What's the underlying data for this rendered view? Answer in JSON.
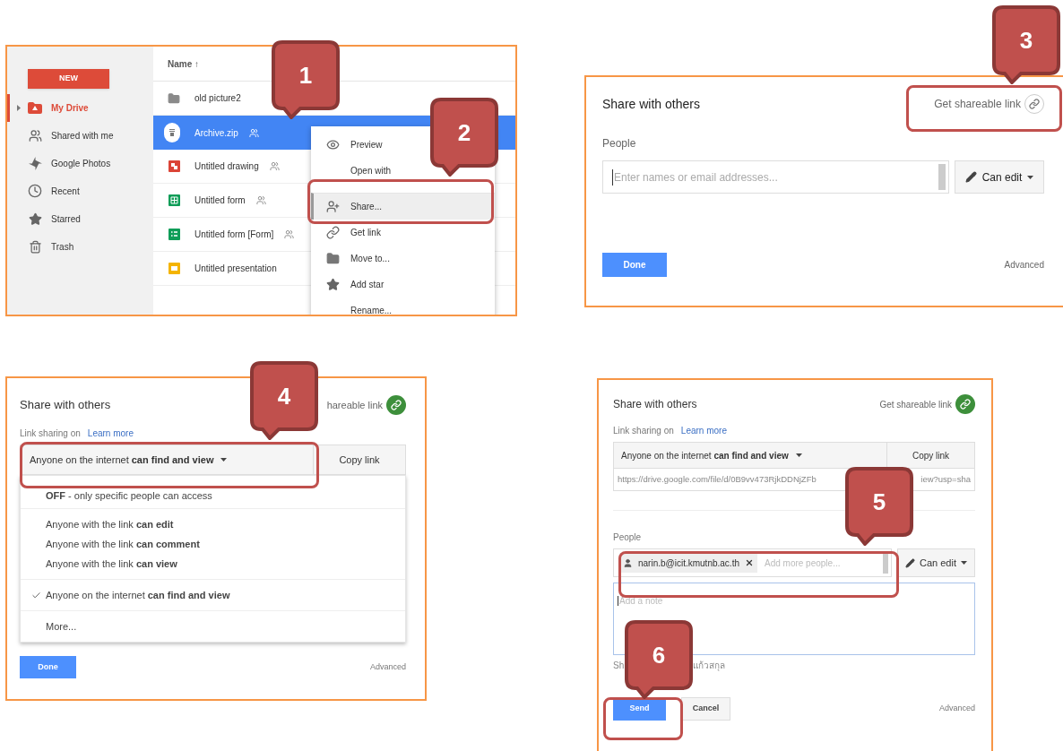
{
  "drive": {
    "new_button": "NEW",
    "nav": [
      {
        "label": "My Drive",
        "selected": true,
        "expandable": true
      },
      {
        "label": "Shared with me",
        "selected": false,
        "expandable": false
      },
      {
        "label": "Google Photos",
        "selected": false,
        "expandable": false
      },
      {
        "label": "Recent",
        "selected": false,
        "expandable": false
      },
      {
        "label": "Starred",
        "selected": false,
        "expandable": false
      },
      {
        "label": "Trash",
        "selected": false,
        "expandable": false
      }
    ],
    "column_header": "Name ↑",
    "files": [
      {
        "name": "old picture2",
        "kind": "folder",
        "shared": false,
        "selected": false
      },
      {
        "name": "Archive.zip",
        "kind": "zip",
        "shared": true,
        "selected": true
      },
      {
        "name": "Untitled drawing",
        "kind": "drawing",
        "shared": true,
        "selected": false
      },
      {
        "name": "Untitled form",
        "kind": "sheet",
        "shared": true,
        "selected": false
      },
      {
        "name": "Untitled form [Form]",
        "kind": "form",
        "shared": true,
        "selected": false
      },
      {
        "name": "Untitled presentation",
        "kind": "slides",
        "shared": false,
        "selected": false
      }
    ],
    "context_menu": [
      {
        "label": "Preview",
        "highlighted": false
      },
      {
        "label": "Open with",
        "highlighted": false
      },
      {
        "label": "Share...",
        "highlighted": true
      },
      {
        "label": "Get link",
        "highlighted": false
      },
      {
        "label": "Move to...",
        "highlighted": false
      },
      {
        "label": "Add star",
        "highlighted": false
      },
      {
        "label": "Rename...",
        "highlighted": false
      }
    ]
  },
  "share_start": {
    "title": "Share with others",
    "link_label": "Get shareable link",
    "link_sharing_on": false,
    "people_label": "People",
    "people_placeholder": "Enter names or email addresses...",
    "permission": "Can edit",
    "done": "Done",
    "advanced": "Advanced"
  },
  "share_link_menu": {
    "title": "Share with others",
    "link_label": "hareable link",
    "link_sharing_on": true,
    "link_status": "Link sharing on",
    "learn_more": "Learn more",
    "access": "Anyone on the internet **can find and view**",
    "copy_link": "Copy link",
    "option_groups": [
      [
        {
          "label": "**OFF** - only specific people can access",
          "checked": false
        }
      ],
      [
        {
          "label": "Anyone with the link **can edit**",
          "checked": false
        },
        {
          "label": "Anyone with the link **can comment**",
          "checked": false
        },
        {
          "label": "Anyone with the link **can view**",
          "checked": false
        }
      ],
      [
        {
          "label": "Anyone on the internet **can find and view**",
          "checked": true
        }
      ],
      [
        {
          "label": "More...",
          "checked": false
        }
      ]
    ],
    "done": "Done",
    "advanced": "Advanced"
  },
  "share_send": {
    "title": "Share with others",
    "link_label": "Get shareable link",
    "link_sharing_on": true,
    "link_status": "Link sharing on",
    "learn_more": "Learn more",
    "access": "Anyone on the internet **can find and view**",
    "copy_link": "Copy link",
    "url_start": "https://drive.google.com/file/d/0B9vv473RjkDDNjZFb",
    "url_end": "iew?usp=sha",
    "people_label": "People",
    "recipient": "narin.b@icit.kmutnb.ac.th",
    "people_placeholder": "Add more people...",
    "permission": "Can edit",
    "note_placeholder": "Add a note",
    "notice_start": "Sh",
    "notice_end": "แก้วสกุล",
    "send": "Send",
    "cancel": "Cancel",
    "advanced": "Advanced"
  },
  "callouts": [
    {
      "number": "1"
    },
    {
      "number": "2"
    },
    {
      "number": "3"
    },
    {
      "number": "4"
    },
    {
      "number": "5"
    },
    {
      "number": "6"
    }
  ]
}
